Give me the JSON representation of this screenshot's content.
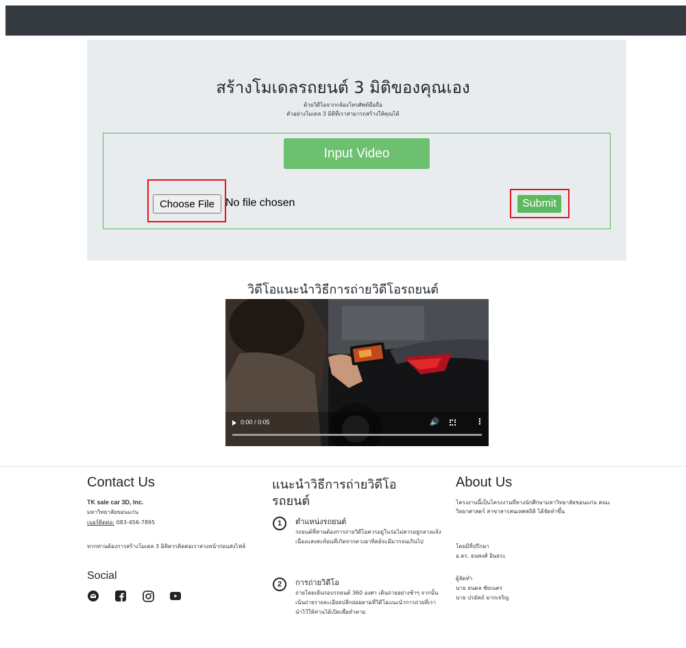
{
  "hero": {
    "title": "สร้างโมเดลรถยนต์ 3 มิติของคุณเอง",
    "subtitle1": "ด้วยวิดีโอจากกล้องโทรศัพท์มือถือ",
    "subtitle2": "ตัวอย่างโมเดล 3 มิติที่เราสามารถสร้างให้คุณได้"
  },
  "upload": {
    "input_video_label": "Input Video",
    "choose_file_label": "Choose File",
    "no_file_text": "No file chosen",
    "submit_label": "Submit"
  },
  "video": {
    "title": "วิดีโอแนะนำวิธีการถ่ายวิดีโอรถยนต์",
    "time": "0:00 / 0:05",
    "progress": 0
  },
  "contact": {
    "title": "Contact Us",
    "company": "TK sale car 3D, Inc.",
    "university": "มหาวิทยาลัยขอนแก่น",
    "phone_label": "เบอร์ติดต่อ:",
    "phone": "083-456-7895",
    "note": "หากท่านต้องการสร้างโมเดล 3 มิติควรติดต่อเราล่วงหน้าก่อนส่งไฟล์"
  },
  "social": {
    "title": "Social",
    "icons": [
      "email-icon",
      "facebook-icon",
      "instagram-icon",
      "youtube-icon"
    ]
  },
  "guide": {
    "title": "แนะนำวิธีการถ่ายวิดีโอรถยนต์",
    "steps": [
      {
        "num": "1",
        "heading": "ตำแหน่งรถยนต์",
        "body": "รถยนต์ที่ท่านต้องการถ่ายวิดีโอควรอยู่ในร่มไม่ควรอยู่กลางแจ้งเนื่องแสงสะท้อนที่เกิดจากดวงอาทิตย์จะมีมากจนเกินไป"
      },
      {
        "num": "2",
        "heading": "การถ่ายวิดีโอ",
        "body": "ถ่ายโดยเดินรอบรถยนต์ 360 องศา เดินถ่ายอย่างช้าๆ จากนั้นเน้นถ่ายรายละเอียดปลีกย่อยตามที่วิดีโอแนะนำการถ่ายที่เรานำไว้ให้ท่านได้เปิดเพื่อทำตาม"
      }
    ]
  },
  "about": {
    "title": "About Us",
    "description": "โครงงานนี้เป็นโครงงานที่ทางนักศึกษามหาวิทยาลัยขอนแก่น คณะวิทยาศาสตร์ สาขาสารสนเทศสถิติ ได้จัดทำขึ้น",
    "advisor_heading": "โดยมีที่ปรึกษา",
    "advisor": "อ.ดร. ธนพงศ์ อินธระ",
    "makers_heading": "ผู้จัดทำ",
    "maker1": "นาย ธนดล ชัยเนตร",
    "maker2": "นาย ปรมัตถ์ มากเจริญ"
  },
  "colors": {
    "navbar": "#343a40",
    "jumbotron": "#e9ecef",
    "success": "#5cb85c",
    "highlight": "#e0141e"
  }
}
